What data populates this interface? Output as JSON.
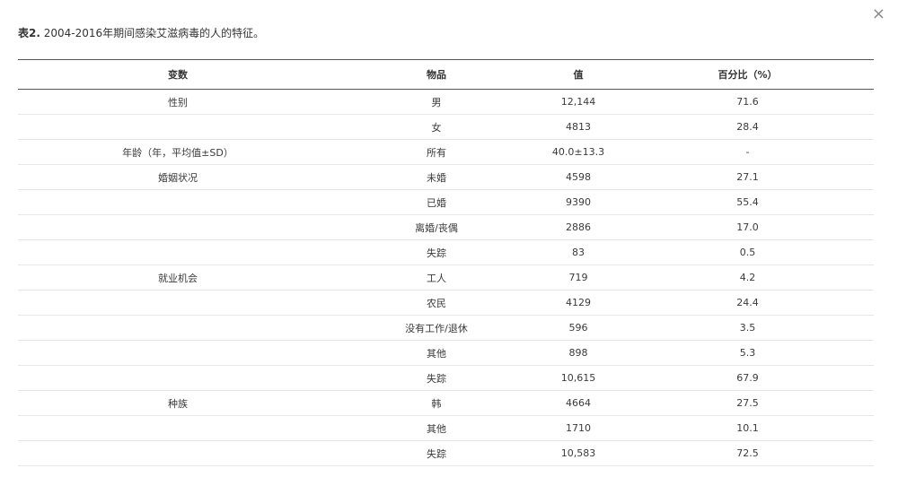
{
  "dialog": {
    "close_label": "×"
  },
  "caption": {
    "label": "表2.",
    "text": " 2004-2016年期间感染艾滋病毒的人的特征。"
  },
  "table": {
    "headers": [
      "变数",
      "物品",
      "值",
      "百分比（%）"
    ],
    "rows": [
      [
        "性别",
        "男",
        "12,144",
        "71.6"
      ],
      [
        "",
        "女",
        "4813",
        "28.4"
      ],
      [
        "年龄（年，平均值±SD）",
        "所有",
        "40.0±13.3",
        "-"
      ],
      [
        "婚姻状况",
        "未婚",
        "4598",
        "27.1"
      ],
      [
        "",
        "已婚",
        "9390",
        "55.4"
      ],
      [
        "",
        "离婚/丧偶",
        "2886",
        "17.0"
      ],
      [
        "",
        "失踪",
        "83",
        "0.5"
      ],
      [
        "就业机会",
        "工人",
        "719",
        "4.2"
      ],
      [
        "",
        "农民",
        "4129",
        "24.4"
      ],
      [
        "",
        "没有工作/退休",
        "596",
        "3.5"
      ],
      [
        "",
        "其他",
        "898",
        "5.3"
      ],
      [
        "",
        "失踪",
        "10,615",
        "67.9"
      ],
      [
        "种族",
        "韩",
        "4664",
        "27.5"
      ],
      [
        "",
        "其他",
        "1710",
        "10.1"
      ],
      [
        "",
        "失踪",
        "10,583",
        "72.5"
      ]
    ]
  }
}
